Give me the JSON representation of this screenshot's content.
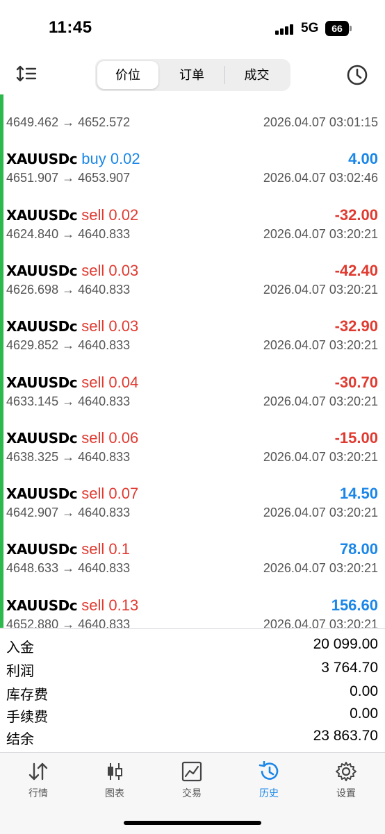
{
  "status": {
    "time": "11:45",
    "network": "5G",
    "battery": "66"
  },
  "toolbar": {
    "segments": [
      {
        "label": "价位"
      },
      {
        "label": "订单"
      },
      {
        "label": "成交"
      }
    ]
  },
  "trades": [
    {
      "symbol": "",
      "side": "",
      "side_class": "buy",
      "profit": "",
      "profit_class": "pos",
      "prices": "4649.462 → 4652.572",
      "time": "2026.04.07 03:01:15"
    },
    {
      "symbol": "XAUUSDc",
      "side": "buy 0.02",
      "side_class": "buy",
      "profit": "4.00",
      "profit_class": "pos",
      "prices": "4651.907 → 4653.907",
      "time": "2026.04.07 03:02:46"
    },
    {
      "symbol": "XAUUSDc",
      "side": "sell 0.02",
      "side_class": "sell",
      "profit": "-32.00",
      "profit_class": "neg",
      "prices": "4624.840 → 4640.833",
      "time": "2026.04.07 03:20:21"
    },
    {
      "symbol": "XAUUSDc",
      "side": "sell 0.03",
      "side_class": "sell",
      "profit": "-42.40",
      "profit_class": "neg",
      "prices": "4626.698 → 4640.833",
      "time": "2026.04.07 03:20:21"
    },
    {
      "symbol": "XAUUSDc",
      "side": "sell 0.03",
      "side_class": "sell",
      "profit": "-32.90",
      "profit_class": "neg",
      "prices": "4629.852 → 4640.833",
      "time": "2026.04.07 03:20:21"
    },
    {
      "symbol": "XAUUSDc",
      "side": "sell 0.04",
      "side_class": "sell",
      "profit": "-30.70",
      "profit_class": "neg",
      "prices": "4633.145 → 4640.833",
      "time": "2026.04.07 03:20:21"
    },
    {
      "symbol": "XAUUSDc",
      "side": "sell 0.06",
      "side_class": "sell",
      "profit": "-15.00",
      "profit_class": "neg",
      "prices": "4638.325 → 4640.833",
      "time": "2026.04.07 03:20:21"
    },
    {
      "symbol": "XAUUSDc",
      "side": "sell 0.07",
      "side_class": "sell",
      "profit": "14.50",
      "profit_class": "pos",
      "prices": "4642.907 → 4640.833",
      "time": "2026.04.07 03:20:21"
    },
    {
      "symbol": "XAUUSDc",
      "side": "sell 0.1",
      "side_class": "sell",
      "profit": "78.00",
      "profit_class": "pos",
      "prices": "4648.633 → 4640.833",
      "time": "2026.04.07 03:20:21"
    },
    {
      "symbol": "XAUUSDc",
      "side": "sell 0.13",
      "side_class": "sell",
      "profit": "156.60",
      "profit_class": "pos",
      "prices": "4652.880 → 4640.833",
      "time": "2026.04.07 03:20:21"
    }
  ],
  "summary": [
    {
      "label": "入金",
      "value": "20 099.00"
    },
    {
      "label": "利润",
      "value": "3 764.70"
    },
    {
      "label": "库存费",
      "value": "0.00"
    },
    {
      "label": "手续费",
      "value": "0.00"
    },
    {
      "label": "结余",
      "value": "23 863.70"
    }
  ],
  "tabs": [
    {
      "label": "行情",
      "icon": "quotes-arrows-icon",
      "active": false
    },
    {
      "label": "图表",
      "icon": "candlestick-chart-icon",
      "active": false
    },
    {
      "label": "交易",
      "icon": "trade-chart-icon",
      "active": false
    },
    {
      "label": "历史",
      "icon": "history-clock-icon",
      "active": true
    },
    {
      "label": "设置",
      "icon": "settings-gear-icon",
      "active": false
    }
  ],
  "colors": {
    "accent": "#1a86e8",
    "loss": "#e03a30",
    "indicator": "#2db84c"
  }
}
